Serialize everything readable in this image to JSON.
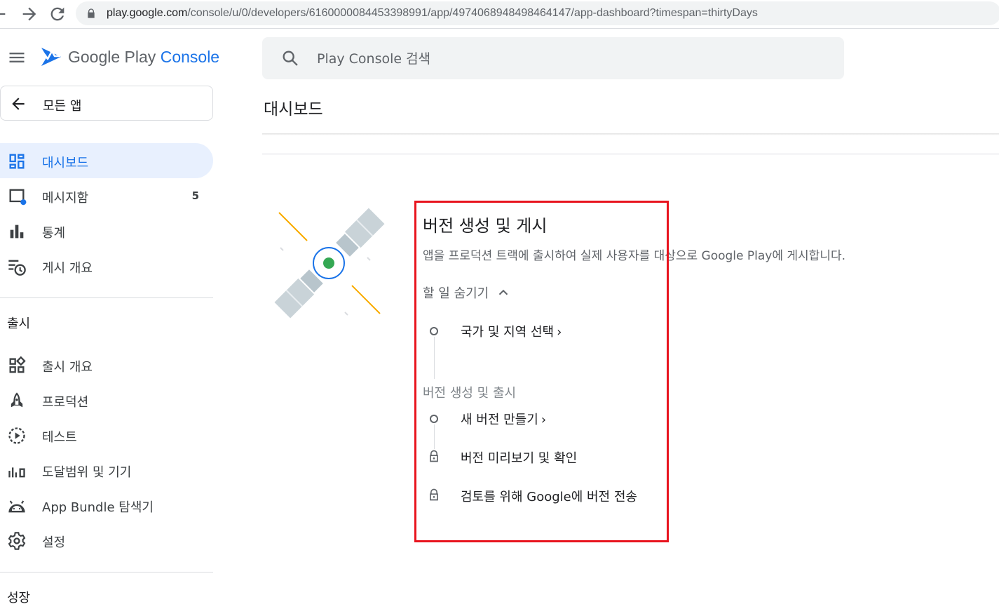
{
  "browser": {
    "url_host": "play.google.com",
    "url_path": "/console/u/0/developers/6160000084453398991/app/4974068948498464147/app-dashboard?timespan=thirtyDays"
  },
  "brand": {
    "google_play": "Google Play",
    "console": "Console"
  },
  "sidebar": {
    "all_apps": "모든 앱",
    "items": [
      {
        "label": "대시보드",
        "icon": "dashboard-icon",
        "active": true
      },
      {
        "label": "메시지함",
        "icon": "inbox-icon",
        "count": "5"
      },
      {
        "label": "통계",
        "icon": "bar-chart-icon"
      },
      {
        "label": "게시 개요",
        "icon": "publishing-overview-icon"
      }
    ],
    "section_release": "출시",
    "release_items": [
      {
        "label": "출시 개요",
        "icon": "release-overview-icon"
      },
      {
        "label": "프로덕션",
        "icon": "rocket-icon"
      },
      {
        "label": "테스트",
        "icon": "testing-icon"
      },
      {
        "label": "도달범위 및 기기",
        "icon": "reach-devices-icon"
      },
      {
        "label": "App Bundle 탐색기",
        "icon": "android-icon"
      },
      {
        "label": "설정",
        "icon": "gear-icon"
      }
    ],
    "section_grow": "성장"
  },
  "search": {
    "placeholder": "Play Console 검색"
  },
  "page_title": "대시보드",
  "card": {
    "title": "버전 생성 및 게시",
    "description": "앱을 프로덕션 트랙에 출시하여 실제 사용자를 대상으로 Google Play에 게시합니다.",
    "hide_todo": "할 일 숨기기",
    "task_country": "국가 및 지역 선택",
    "sub_section": "버전 생성 및 출시",
    "task_new_release": "새 버전 만들기",
    "task_preview": "버전 미리보기 및 확인",
    "task_send_review": "검토를 위해 Google에 버전 전송"
  },
  "colors": {
    "accent": "#1a73e8",
    "active_bg": "#e8f0fe",
    "highlight": "#e8141e"
  }
}
